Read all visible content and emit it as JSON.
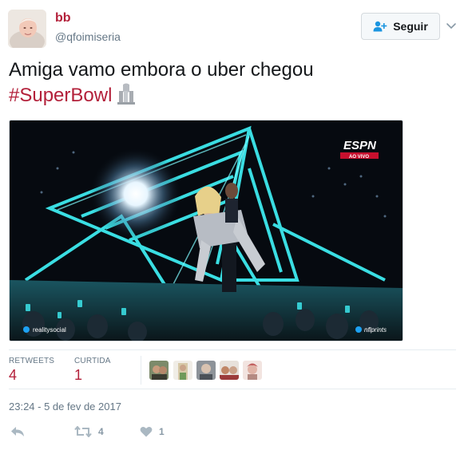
{
  "author": {
    "display_name": "bb",
    "username": "@qfoimiseria"
  },
  "follow_button": {
    "label": "Seguir"
  },
  "tweet": {
    "text": "Amiga vamo embora o uber chegou",
    "hashtag": "#SuperBowl",
    "hashtag_logo_icon": "super-bowl-li-logo"
  },
  "media": {
    "broadcast_logo": "ESPN",
    "broadcast_tag": "AO VIVO",
    "watermark_left": "realitysocial",
    "watermark_right": "nflprints"
  },
  "stats": {
    "retweets_label": "RETWEETS",
    "retweets_count": "4",
    "likes_label": "CURTIDA",
    "likes_count": "1"
  },
  "timestamp": "23:24 - 5 de fev de 2017",
  "actions": {
    "reply_icon": "reply-icon",
    "retweet_icon": "retweet-icon",
    "retweet_count": "4",
    "like_icon": "heart-icon",
    "like_count": "1"
  },
  "colors": {
    "accent": "#b3203a",
    "muted": "#657786",
    "icon": "#8899a6",
    "stage_cyan": "#3ff0f5"
  }
}
